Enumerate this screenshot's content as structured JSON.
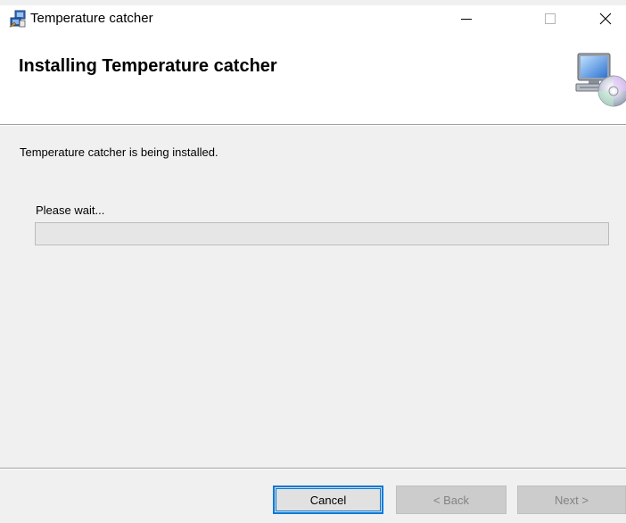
{
  "window": {
    "title": "Temperature catcher",
    "icon": "installer-icon",
    "controls": {
      "minimize": "minimize-icon",
      "maximize": "maximize-icon",
      "close": "close-icon"
    }
  },
  "header": {
    "title": "Installing Temperature catcher",
    "icon": "computer-disc-icon"
  },
  "body": {
    "status": "Temperature catcher is being installed.",
    "wait_label": "Please wait...",
    "progress": 0
  },
  "footer": {
    "cancel_label": "Cancel",
    "back_label": "< Back",
    "next_label": "Next >"
  },
  "colors": {
    "accent": "#0078d7",
    "window_bg": "#f0f0f0",
    "header_bg": "#ffffff",
    "progress_fill": "#06b025"
  }
}
